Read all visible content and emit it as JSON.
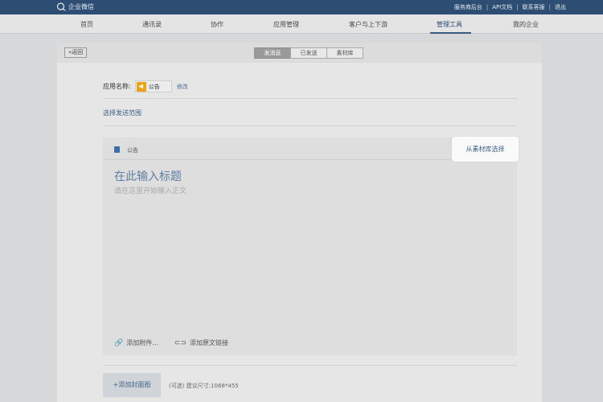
{
  "header": {
    "brand": "企业微信",
    "links": [
      "服务商后台",
      "API文档",
      "联系客服",
      "退出"
    ]
  },
  "nav": {
    "items": [
      "首页",
      "通讯录",
      "协作",
      "应用管理",
      "客户与上下游",
      "管理工具",
      "我的企业"
    ],
    "active": "管理工具"
  },
  "toolbar": {
    "back_label": "返回",
    "tabs": [
      "发消息",
      "已发送",
      "素材库"
    ],
    "active_tab": "发消息"
  },
  "form": {
    "app_name_label": "应用名称:",
    "app_name": "公告",
    "modify_label": "修改",
    "scope_label": "选择发送范围"
  },
  "editor": {
    "type_label": "公告",
    "library_button": "从素材库选择",
    "title_placeholder": "在此输入标题",
    "body_placeholder": "请在这里开始输入正文",
    "attach_label": "添加附件...",
    "link_label": "添加原文链接"
  },
  "cover": {
    "button_label": "+添加封面图",
    "hint": "(可选) 建议尺寸:1068*455"
  },
  "colors": {
    "topbar": "#2e4d73",
    "accent": "#3e5f85",
    "app_icon": "#e8a317"
  }
}
